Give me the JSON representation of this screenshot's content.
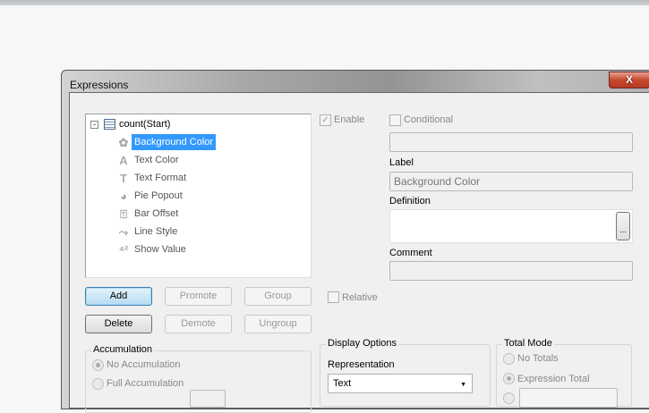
{
  "window": {
    "title": "Expressions",
    "close_label": "X"
  },
  "tree": {
    "root": "count(Start)",
    "items": [
      {
        "label": "Background Color",
        "icon": "palette-icon",
        "glyph": "✿",
        "selected": true
      },
      {
        "label": "Text Color",
        "icon": "text-color-icon",
        "glyph": "A"
      },
      {
        "label": "Text Format",
        "icon": "text-format-icon",
        "glyph": "T"
      },
      {
        "label": "Pie Popout",
        "icon": "pie-icon",
        "glyph": "◕"
      },
      {
        "label": "Bar Offset",
        "icon": "bar-offset-icon",
        "glyph": "⍐"
      },
      {
        "label": "Line Style",
        "icon": "line-style-icon",
        "glyph": "⤳"
      },
      {
        "label": "Show Value",
        "icon": "show-value-icon",
        "glyph": "⁴²"
      }
    ]
  },
  "form": {
    "enable": "Enable",
    "enable_checked": true,
    "conditional": "Conditional",
    "conditional_checked": false,
    "label_caption": "Label",
    "label_value": "Background Color",
    "definition_caption": "Definition",
    "definition_btn": "...",
    "comment_caption": "Comment",
    "relative": "Relative"
  },
  "buttons": {
    "add": "Add",
    "promote": "Promote",
    "group": "Group",
    "delete": "Delete",
    "demote": "Demote",
    "ungroup": "Ungroup"
  },
  "accumulation": {
    "title": "Accumulation",
    "options": [
      "No Accumulation",
      "Full Accumulation"
    ],
    "selected": "No Accumulation"
  },
  "display": {
    "title": "Display Options",
    "representation_label": "Representation",
    "representation_value": "Text"
  },
  "total": {
    "title": "Total Mode",
    "options": [
      "No Totals",
      "Expression Total"
    ],
    "selected": "Expression Total"
  }
}
